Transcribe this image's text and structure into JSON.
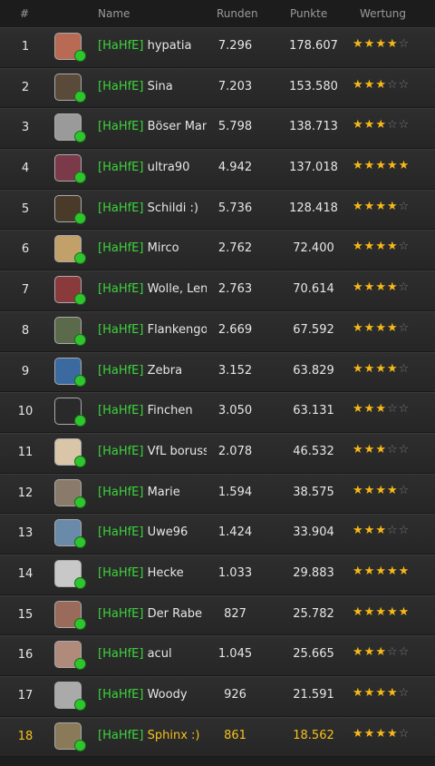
{
  "header": {
    "rank": "#",
    "name": "Name",
    "runden": "Runden",
    "punkte": "Punkte",
    "wertung": "Wertung"
  },
  "clan_tag": "[HaHfE]",
  "star_total": 5,
  "rows": [
    {
      "rank": "1",
      "nick": "hypatia",
      "runden": "7.296",
      "punkte": "178.607",
      "stars": 4,
      "avatar_color": "#b86a55"
    },
    {
      "rank": "2",
      "nick": "Sina",
      "runden": "7.203",
      "punkte": "153.580",
      "stars": 3,
      "avatar_color": "#5a4a3a"
    },
    {
      "rank": "3",
      "nick": "Böser Man",
      "runden": "5.798",
      "punkte": "138.713",
      "stars": 3,
      "avatar_color": "#9a9a9a"
    },
    {
      "rank": "4",
      "nick": "ultra90",
      "runden": "4.942",
      "punkte": "137.018",
      "stars": 5,
      "avatar_color": "#7a3a4a"
    },
    {
      "rank": "5",
      "nick": "Schildi :)",
      "runden": "5.736",
      "punkte": "128.418",
      "stars": 4,
      "avatar_color": "#4a3a2a"
    },
    {
      "rank": "6",
      "nick": "Mirco",
      "runden": "2.762",
      "punkte": "72.400",
      "stars": 4,
      "avatar_color": "#c2a06a"
    },
    {
      "rank": "7",
      "nick": "Wolle, Lens",
      "runden": "2.763",
      "punkte": "70.614",
      "stars": 4,
      "avatar_color": "#8a3a3a"
    },
    {
      "rank": "8",
      "nick": "Flankengott",
      "runden": "2.669",
      "punkte": "67.592",
      "stars": 4,
      "avatar_color": "#5a6a4a"
    },
    {
      "rank": "9",
      "nick": "Zebra",
      "runden": "3.152",
      "punkte": "63.829",
      "stars": 4,
      "avatar_color": "#3a6aa0"
    },
    {
      "rank": "10",
      "nick": "Finchen",
      "runden": "3.050",
      "punkte": "63.131",
      "stars": 3,
      "avatar_color": "#2a2a2a"
    },
    {
      "rank": "11",
      "nick": "VfL borussia",
      "runden": "2.078",
      "punkte": "46.532",
      "stars": 3,
      "avatar_color": "#d9c6a8"
    },
    {
      "rank": "12",
      "nick": "Marie",
      "runden": "1.594",
      "punkte": "38.575",
      "stars": 4,
      "avatar_color": "#8a7a6a"
    },
    {
      "rank": "13",
      "nick": "Uwe96",
      "runden": "1.424",
      "punkte": "33.904",
      "stars": 3,
      "avatar_color": "#6a8aaa"
    },
    {
      "rank": "14",
      "nick": "Hecke",
      "runden": "1.033",
      "punkte": "29.883",
      "stars": 5,
      "avatar_color": "#c8c8c8"
    },
    {
      "rank": "15",
      "nick": "Der Rabe",
      "runden": "827",
      "punkte": "25.782",
      "stars": 5,
      "avatar_color": "#9a6a5a"
    },
    {
      "rank": "16",
      "nick": "acul",
      "runden": "1.045",
      "punkte": "25.665",
      "stars": 3,
      "avatar_color": "#b08a7a"
    },
    {
      "rank": "17",
      "nick": "Woody",
      "runden": "926",
      "punkte": "21.591",
      "stars": 4,
      "avatar_color": "#aaaaaa"
    },
    {
      "rank": "18",
      "nick": "Sphinx :)",
      "runden": "861",
      "punkte": "18.562",
      "stars": 4,
      "avatar_color": "#8a7a5a",
      "highlight": true
    }
  ]
}
